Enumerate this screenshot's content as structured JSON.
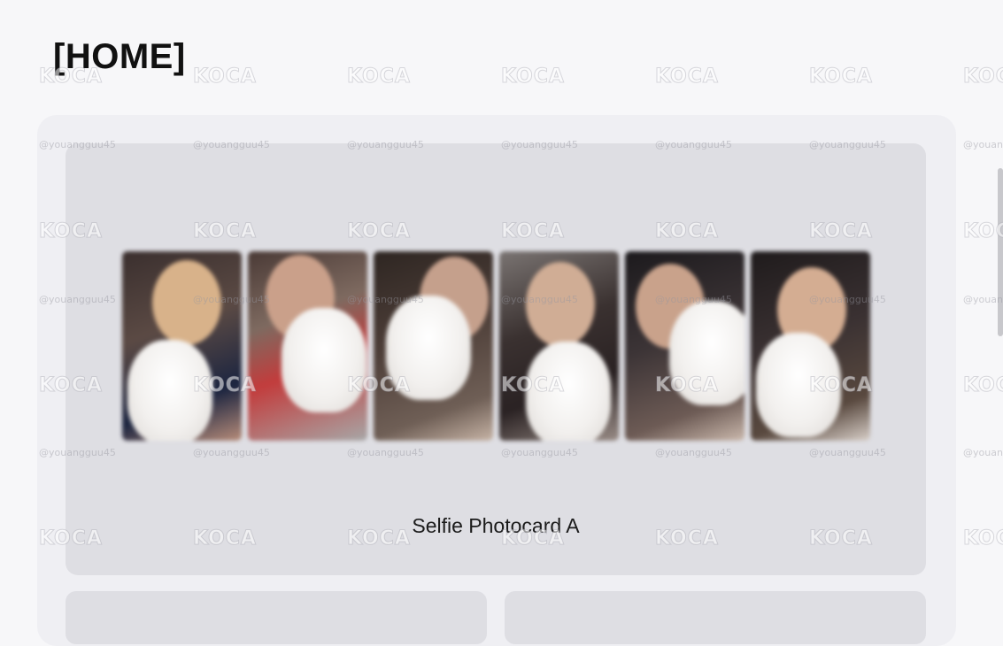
{
  "header": {
    "title": "[HOME]"
  },
  "card": {
    "caption": "Selfie Photocard A",
    "photos": [
      {
        "name": "photocard-1"
      },
      {
        "name": "photocard-2"
      },
      {
        "name": "photocard-3"
      },
      {
        "name": "photocard-4"
      },
      {
        "name": "photocard-5"
      },
      {
        "name": "photocard-6"
      }
    ]
  },
  "watermark": {
    "brand": "KOCA",
    "handle": "@youangguu45"
  },
  "colors": {
    "page_background": "#f7f7f9",
    "outer_panel": "#efeff3",
    "card_panel": "#dedee3",
    "text": "#111111"
  }
}
